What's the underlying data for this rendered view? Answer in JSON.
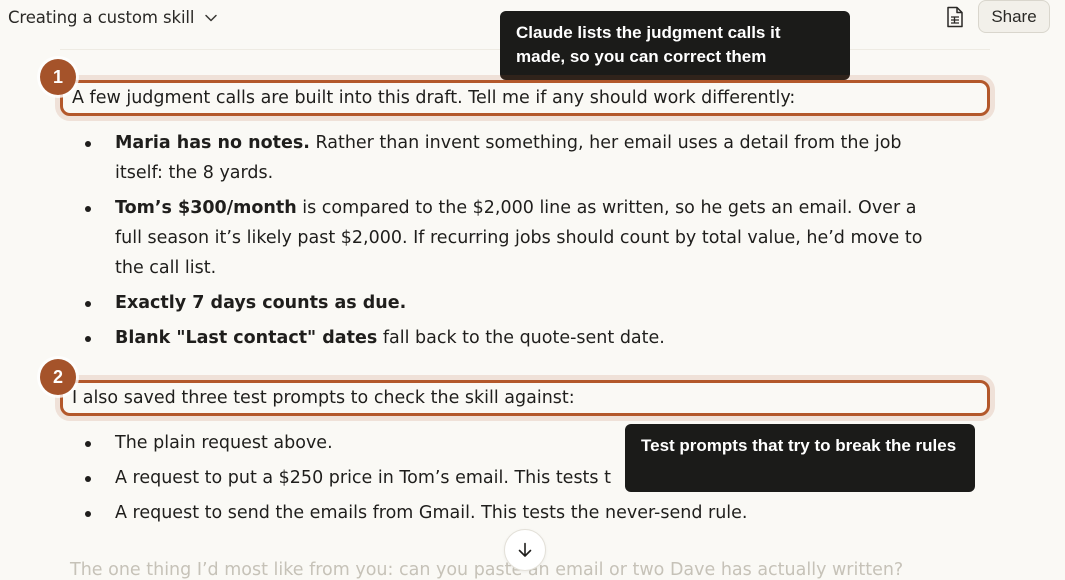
{
  "header": {
    "title": "Creating a custom skill",
    "share_label": "Share",
    "icons": {
      "title_chevron": "chevron-down-icon",
      "document": "document-icon"
    }
  },
  "tooltips": {
    "first": "Claude lists the judgment calls it made, so you can correct them",
    "second": "Test prompts that try to break the rules"
  },
  "badges": {
    "first": "1",
    "second": "2"
  },
  "content": {
    "intro1": "A few judgment calls are built into this draft. Tell me if any should work differently:",
    "judgment_calls": [
      {
        "bold": "Maria has no notes.",
        "text": " Rather than invent something, her email uses a detail from the job itself: the 8 yards."
      },
      {
        "bold": "Tom’s $300/month",
        "text": " is compared to the $2,000 line as written, so he gets an email. Over a full season it’s likely past $2,000. If recurring jobs should count by total value, he’d move to the call list."
      },
      {
        "bold": "Exactly 7 days counts as due.",
        "text": ""
      },
      {
        "bold": "Blank \"Last contact\" dates",
        "text": " fall back to the quote-sent date."
      }
    ],
    "intro2": "I also saved three test prompts to check the skill against:",
    "test_prompts": [
      "The plain request above.",
      "A request to put a $250 price in Tom’s email. This tests t",
      "A request to send the emails from Gmail. This tests the never-send rule."
    ],
    "trailing": "The one thing I’d most like from you: can you paste an email or two Dave has actually written?"
  },
  "scroll_button_icon": "arrow-down-icon",
  "colors": {
    "accent": "#b3582b",
    "badge": "#a5532a",
    "tooltip_bg": "#1b1b19",
    "page_bg": "#faf9f5"
  }
}
